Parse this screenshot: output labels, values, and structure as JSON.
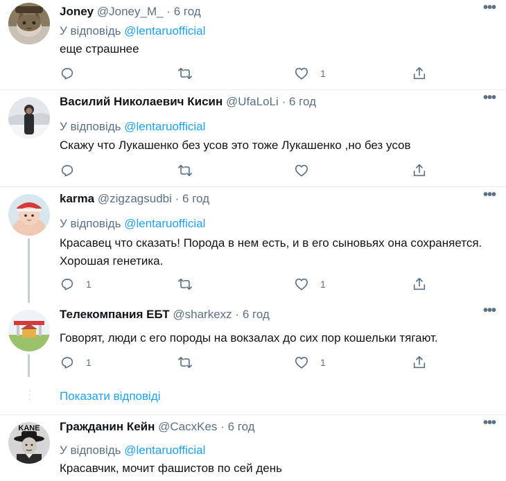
{
  "tweets": [
    {
      "name": "Joney",
      "handle": "@Joney_M_",
      "dot": "·",
      "time": "6 год",
      "reply_prefix": "У відповідь",
      "reply_to": "@lentaruofficial",
      "text": "еще страшнее",
      "replies": "",
      "retweets": "",
      "likes": "1",
      "avatar_icon": "cat-photo-avatar"
    },
    {
      "name": "Василий Николаевич Кисин",
      "handle": "@UfaLoLi",
      "dot": "·",
      "time": "6 год",
      "reply_prefix": "У відповідь",
      "reply_to": "@lentaruofficial",
      "text": "Скажу что Лукашенко без усов это тоже Лукашенко ,но без усов",
      "replies": "",
      "retweets": "",
      "likes": "",
      "avatar_icon": "person-in-snow-avatar"
    },
    {
      "name": "karma",
      "handle": "@zigzagsudbi",
      "dot": "·",
      "time": "6 год",
      "reply_prefix": "У відповідь",
      "reply_to": "@lentaruofficial",
      "text": "Красавец что сказать! Порода  в нем есть, и в его сыновьях она сохраняется. Хорошая генетика.",
      "replies": "1",
      "retweets": "",
      "likes": "1",
      "avatar_icon": "baby-photo-avatar"
    },
    {
      "name": "Телекомпания ЕБТ",
      "handle": "@sharkexz",
      "dot": "·",
      "time": "6 год",
      "text": "Говорят, люди с его породы на вокзалах до сих пор кошельки тягают.",
      "replies": "1",
      "retweets": "",
      "likes": "1",
      "avatar_icon": "gas-station-avatar"
    },
    {
      "name": "Гражданин Кейн",
      "handle": "@CacxKes",
      "dot": "·",
      "time": "6 год",
      "reply_prefix": "У відповідь",
      "reply_to": "@lentaruofficial",
      "text": "Красавчик, мочит фашистов по сей день",
      "avatar_icon": "kane-portrait-avatar",
      "avatar_text": "KANE"
    }
  ],
  "show_replies_label": "Показати відповіді",
  "more_glyph": "•••",
  "colors": {
    "accent": "#1da1f2",
    "secondary_text": "#5b7083",
    "divider": "#e6ecf0",
    "thread_line": "#c4cfd6"
  }
}
